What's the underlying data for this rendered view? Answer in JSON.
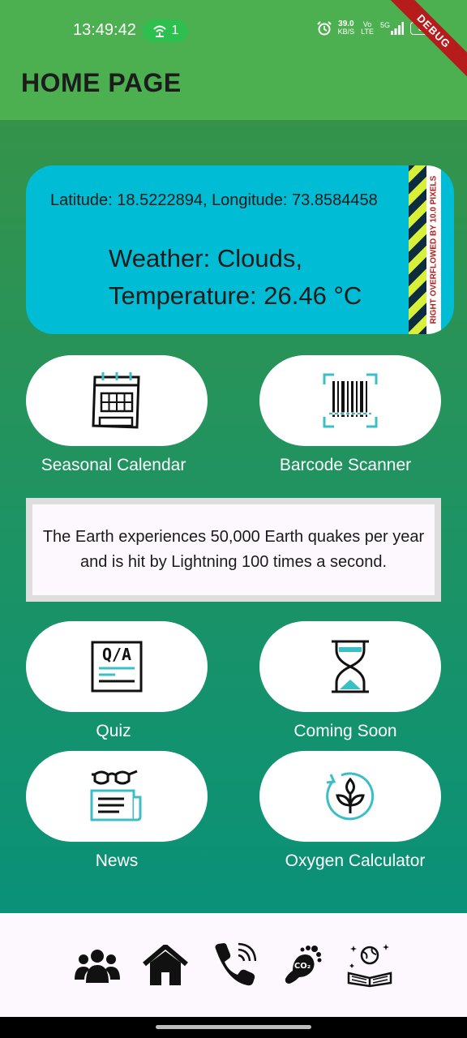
{
  "status_bar": {
    "time": "13:49:42",
    "hotspot_count": "1",
    "net_speed_value": "39.0",
    "net_speed_unit": "KB/S",
    "net_type_top": "Vo",
    "net_type_bottom": "LTE",
    "signal_label": "5G",
    "battery": "30"
  },
  "debug_banner": "DEBUG",
  "app_bar": {
    "title": "HOME PAGE"
  },
  "weather": {
    "coordinates": "Latitude: 18.5222894, Longitude: 73.8584458",
    "weather_line": "Weather: Clouds,",
    "temperature_line": "Temperature: 26.46 °C",
    "overflow_warning": "RIGHT OVERFLOWED BY 10.0 PIXELS"
  },
  "tiles": {
    "seasonal_calendar": "Seasonal Calendar",
    "barcode_scanner": "Barcode Scanner",
    "quiz": "Quiz",
    "coming_soon": "Coming Soon",
    "news": "News",
    "oxygen_calculator": "Oxygen Calculator"
  },
  "quiz_icon_text": "Q/A",
  "co2_icon_text": "CO₂",
  "fact": "The Earth experiences 50,000 Earth quakes per year and is hit by Lightning 100 times a second.",
  "bottom_nav_icons": [
    "community-icon",
    "home-icon",
    "phone-icon",
    "carbon-footprint-icon",
    "knowledge-book-icon"
  ],
  "colors": {
    "app_bar": "#4caf50",
    "weather_card": "#00bcd4",
    "gradient_top": "#35934a",
    "gradient_bottom": "#0a9178",
    "accent_teal": "#3bbfc7"
  }
}
